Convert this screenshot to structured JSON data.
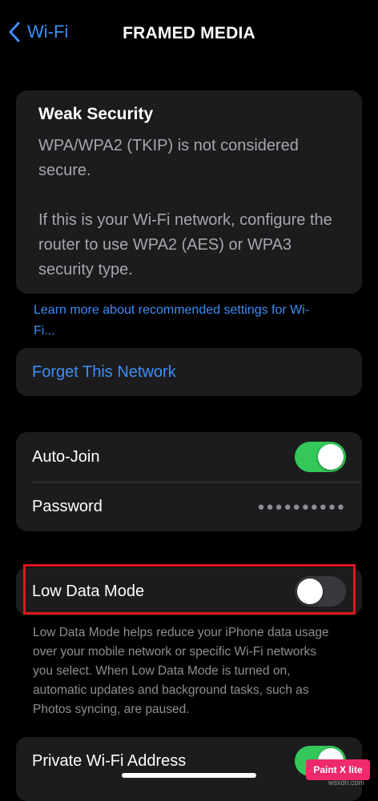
{
  "nav": {
    "back_label": "Wi-Fi",
    "title": "FRAMED MEDIA"
  },
  "warning": {
    "title": "Weak Security",
    "line1": "WPA/WPA2 (TKIP) is not considered secure.",
    "line2": "If this is your Wi-Fi network, configure the router to use WPA2 (AES) or WPA3 security type."
  },
  "learn_more": "Learn more about recommended settings for Wi-Fi...",
  "forget": "Forget This Network",
  "auto_join": {
    "label": "Auto-Join",
    "on": true
  },
  "password": {
    "label": "Password",
    "value": "●●●●●●●●●●"
  },
  "low_data": {
    "label": "Low Data Mode",
    "on": false,
    "description": "Low Data Mode helps reduce your iPhone data usage over your mobile network or specific Wi-Fi networks you select. When Low Data Mode is turned on, automatic updates and background tasks, such as Photos syncing, are paused."
  },
  "private_address": {
    "label": "Private Wi-Fi Address",
    "on": true
  },
  "watermark": {
    "brand": "Paint X lite",
    "site": "wsxdn.com"
  },
  "colors": {
    "accent": "#3d8ef7",
    "toggle_on": "#34c759",
    "highlight": "#e0161c"
  }
}
